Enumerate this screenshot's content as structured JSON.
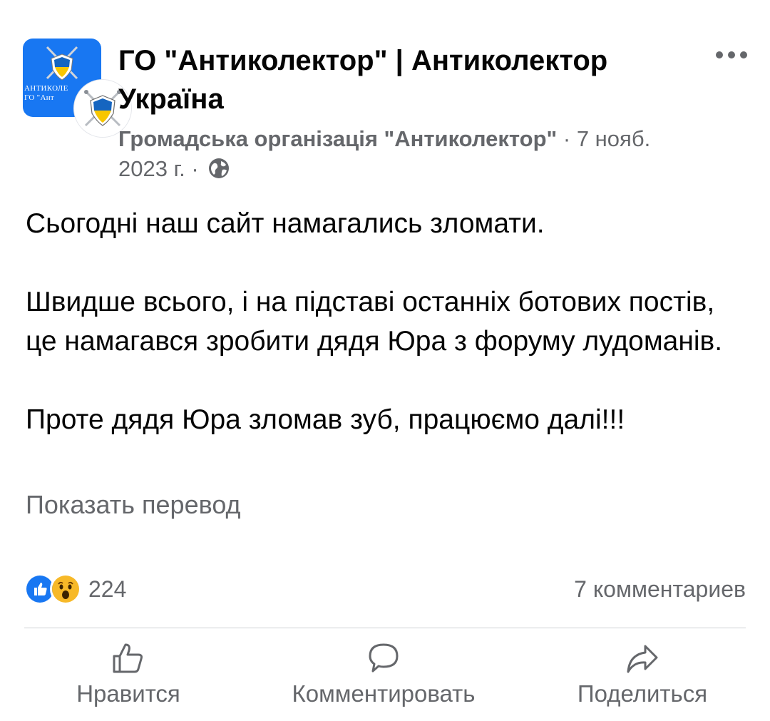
{
  "post": {
    "page_name": "ГО \"Антиколектор\" | Антиколектор Україна",
    "avatar_banner_line1": "АНТИКОЛЕ",
    "avatar_banner_line2": "ГО \"Ант",
    "org_name": "Громадська організація \"Антиколектор\"",
    "separator": "·",
    "date": "7 нояб. 2023 г.",
    "privacy_icon": "globe-icon",
    "paragraphs": [
      "Сьогодні наш сайт намагались зломати.",
      "Швидше всього, і на підставі останніх ботових постів, це намагався зробити дядя Юра з форуму лудоманів.",
      "Проте дядя Юра зломав зуб, працюємо далі!!!"
    ],
    "translate_link": "Показать перевод"
  },
  "stats": {
    "reaction_icons": [
      "like-reaction-icon",
      "wow-reaction-icon"
    ],
    "reaction_count": "224",
    "comments": "7 комментариев"
  },
  "actions": {
    "like": "Нравится",
    "comment": "Комментировать",
    "share": "Поделиться"
  },
  "colors": {
    "facebook_blue": "#1877f2",
    "secondary_text": "#65676b",
    "shield_yellow": "#f7c600",
    "shield_blue": "#1565c0"
  }
}
